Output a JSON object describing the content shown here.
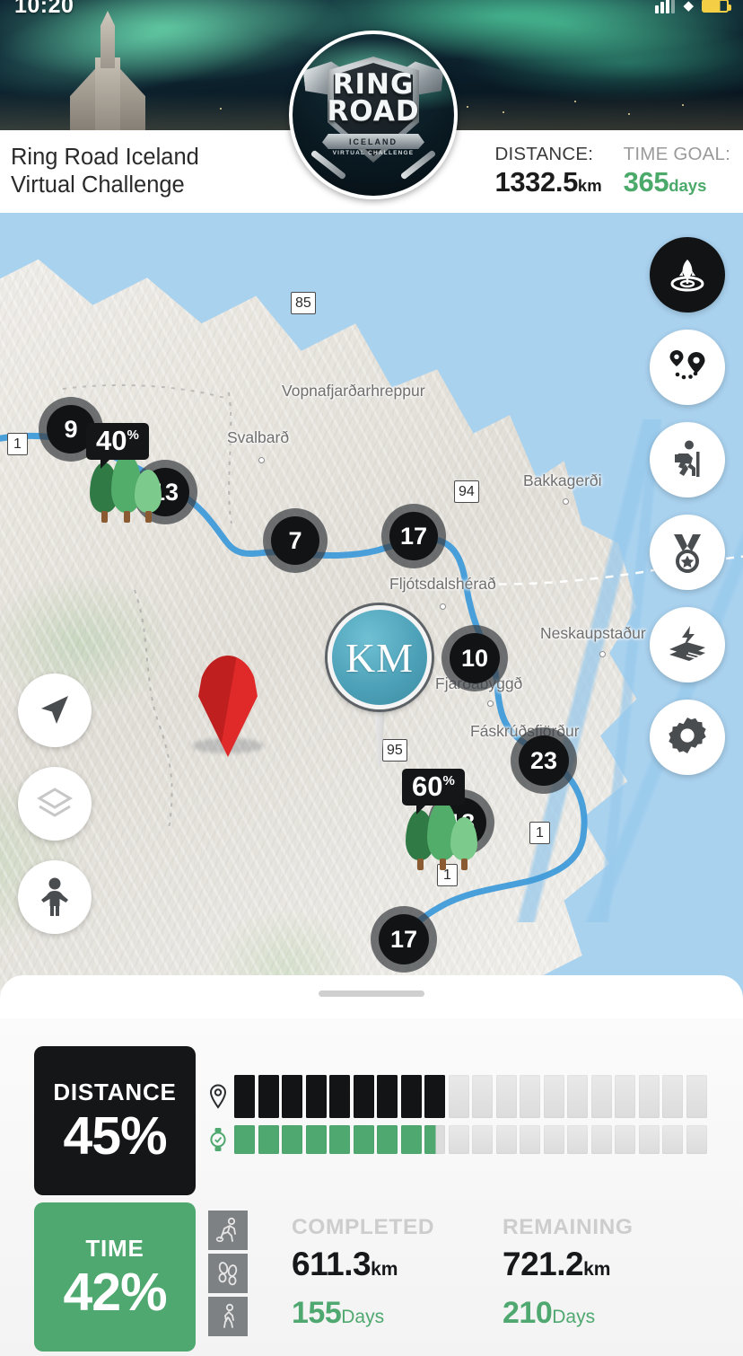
{
  "status_bar": {
    "time": "10:20",
    "battery_icon": "battery-icon",
    "wifi_icon": "wifi-icon",
    "signal_icon": "signal-icon"
  },
  "header": {
    "title": "Ring Road Iceland\nVirtual Challenge",
    "title_line1": "Ring Road Iceland",
    "title_line2": "Virtual Challenge",
    "logo": {
      "line1": "RING",
      "line2": "ROAD",
      "ribbon": "ICELAND",
      "subtitle": "VIRTUAL CHALLENGE"
    },
    "stats": [
      {
        "label": "DISTANCE:",
        "value": "1332.5",
        "unit": "km",
        "color": "#1c1c1c"
      },
      {
        "label": "TIME GOAL:",
        "value": "365",
        "unit": "days",
        "color": "#4ba96a"
      }
    ]
  },
  "map": {
    "current_position_label": "KM",
    "labels": [
      {
        "text": "Svalbarð"
      },
      {
        "text": "Vopnafjarðarhreppur"
      },
      {
        "text": "Bakkagerði"
      },
      {
        "text": "Fljótsdalshérað"
      },
      {
        "text": "Neskaupstaður"
      },
      {
        "text": "Fjarðabyggð"
      },
      {
        "text": "Fáskrúðsfjörður"
      }
    ],
    "road_shields": [
      "1",
      "85",
      "94",
      "95",
      "1",
      "1"
    ],
    "clusters": [
      "9",
      "13",
      "7",
      "17",
      "10",
      "23",
      "18",
      "17"
    ],
    "percent_badges": [
      {
        "value": "40",
        "symbol": "%"
      },
      {
        "value": "60",
        "symbol": "%"
      }
    ],
    "side_buttons": [
      {
        "name": "rocket-target-icon",
        "active": true
      },
      {
        "name": "route-pins-icon",
        "active": false
      },
      {
        "name": "hiker-icon",
        "active": false
      },
      {
        "name": "medal-icon",
        "active": false
      },
      {
        "name": "lightning-book-icon",
        "active": false
      },
      {
        "name": "gear-icon",
        "active": false
      }
    ],
    "left_controls": [
      {
        "name": "navigation-arrow-icon"
      },
      {
        "name": "layers-icon"
      },
      {
        "name": "pegman-icon"
      }
    ]
  },
  "progress": {
    "distance_card": {
      "label": "DISTANCE",
      "value": "45%"
    },
    "time_card": {
      "label": "TIME",
      "value": "42%"
    },
    "distance_bar": {
      "icon": "map-pin-icon",
      "total_segments": 20,
      "filled_segments": 9,
      "color": "#121416"
    },
    "time_bar": {
      "icon": "watch-icon",
      "total_segments": 20,
      "filled_segments": 8,
      "half_segment": true,
      "color": "#4ea86f"
    },
    "activity_toggles": [
      {
        "name": "running-icon"
      },
      {
        "name": "footsteps-icon"
      },
      {
        "name": "walking-icon"
      }
    ],
    "columns": [
      {
        "header": "COMPLETED",
        "distance": "611.3",
        "distance_unit": "km",
        "days": "155",
        "days_unit": "Days"
      },
      {
        "header": "REMAINING",
        "distance": "721.2",
        "distance_unit": "km",
        "days": "210",
        "days_unit": "Days"
      }
    ]
  }
}
